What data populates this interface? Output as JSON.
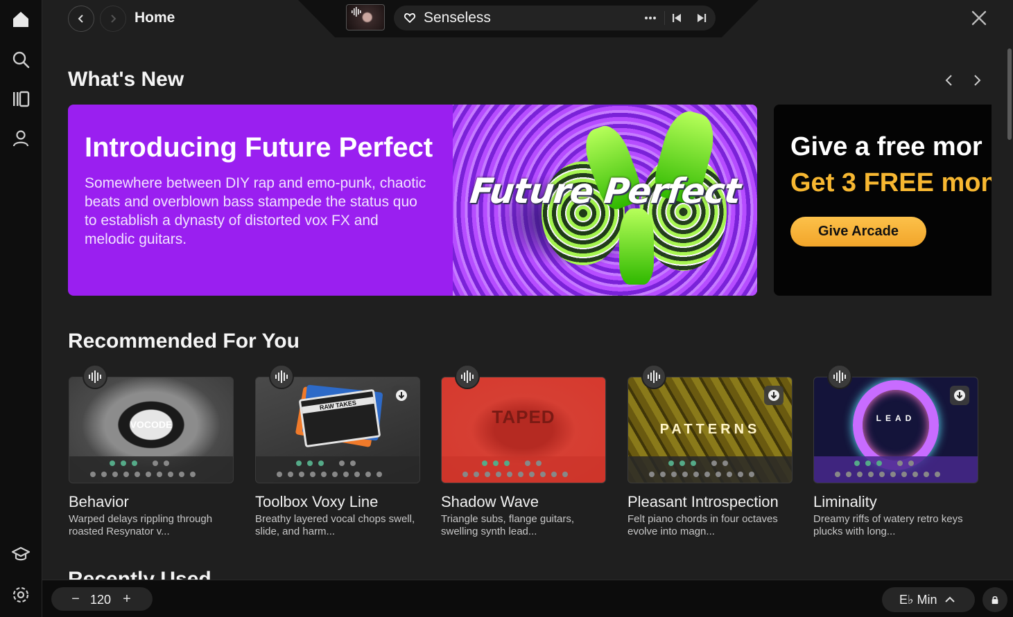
{
  "header": {
    "title": "Home",
    "back_icon": "chevron-left-icon",
    "forward_icon": "chevron-right-icon"
  },
  "player": {
    "song_title": "Senseless",
    "favorite_icon": "heart-icon",
    "more_icon": "more-icon",
    "prev_icon": "skip-previous-icon",
    "next_icon": "skip-next-icon"
  },
  "sidebar": {
    "items": [
      {
        "name": "home",
        "icon": "home-icon"
      },
      {
        "name": "search",
        "icon": "search-icon"
      },
      {
        "name": "library",
        "icon": "library-icon"
      },
      {
        "name": "profile",
        "icon": "user-icon"
      },
      {
        "name": "learn",
        "icon": "graduation-cap-icon"
      },
      {
        "name": "settings",
        "icon": "gear-icon"
      }
    ]
  },
  "whats_new": {
    "title": "What's New",
    "hero": {
      "title": "Introducing Future Perfect",
      "description": "Somewhere between DIY rap and emo-punk, chaotic beats and overblown bass stampede the status quo to establish a dynasty of distorted vox FX and melodic guitars."
    },
    "promo": {
      "line1": "Give a free mor",
      "line2": "Get 3 FREE mon",
      "button": "Give Arcade"
    }
  },
  "recommended": {
    "title": "Recommended For You",
    "cards": [
      {
        "title": "Behavior",
        "description": "Warped delays rippling through roasted Resynator v...",
        "art_label": "VOCODE",
        "downloadable": false
      },
      {
        "title": "Toolbox Voxy Line",
        "description": "Breathy layered vocal chops swell, slide, and harm...",
        "art_label": "RAW TAKES",
        "downloadable": true
      },
      {
        "title": "Shadow Wave",
        "description": "Triangle subs, flange guitars, swelling synth lead...",
        "art_label": "TAPED",
        "downloadable": false
      },
      {
        "title": "Pleasant Introspection",
        "description": "Felt piano chords in four octaves evolve into magn...",
        "art_label": "PATTERNS",
        "downloadable": true
      },
      {
        "title": "Liminality",
        "description": "Dreamy riffs of watery retro keys plucks with long...",
        "art_label": "LEAD",
        "downloadable": true
      }
    ]
  },
  "recently_used": {
    "title": "Recently Used"
  },
  "footer": {
    "tempo": "120",
    "tempo_minus": "−",
    "tempo_plus": "+",
    "key": "E♭ Min",
    "lock_icon": "lock-icon"
  },
  "colors": {
    "hero_bg": "#9a1ff0",
    "promo_accent": "#f7b731"
  }
}
